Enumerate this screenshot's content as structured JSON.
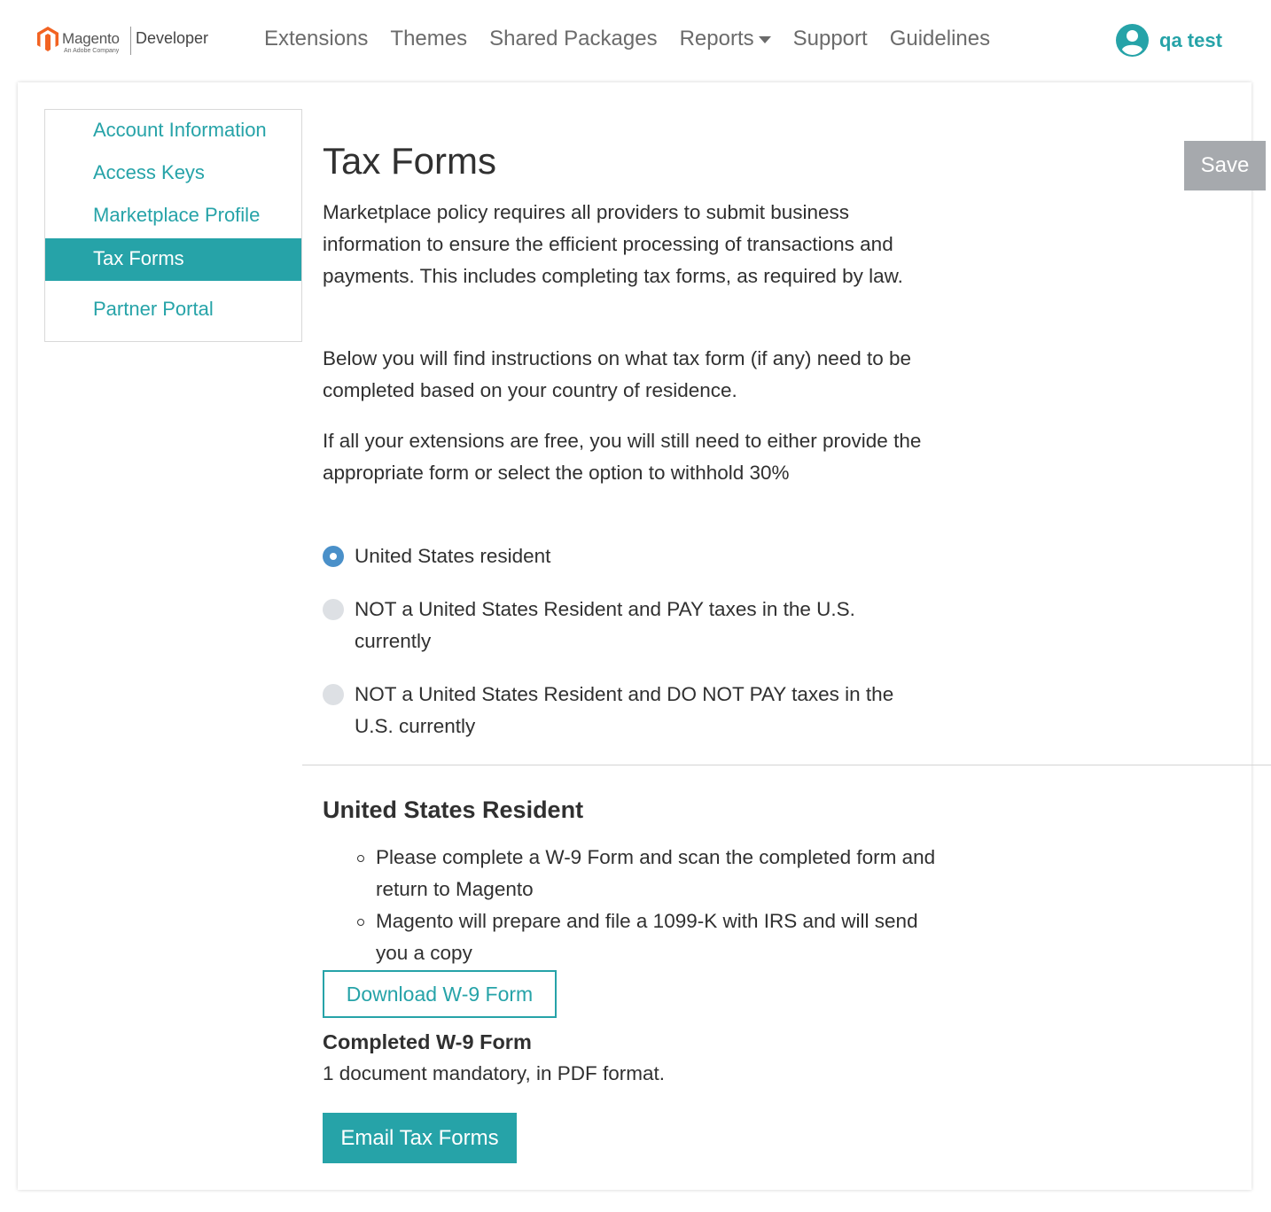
{
  "header": {
    "logo": {
      "brand": "Magento",
      "sub": "An Adobe Company",
      "product": "Developer"
    },
    "nav": [
      {
        "label": "Extensions"
      },
      {
        "label": "Themes"
      },
      {
        "label": "Shared Packages"
      },
      {
        "label": "Reports",
        "dropdown": true
      },
      {
        "label": "Support"
      },
      {
        "label": "Guidelines"
      }
    ],
    "user": {
      "name": "qa test",
      "icon": "user-avatar-icon"
    }
  },
  "sidebar": {
    "items": [
      {
        "label": "Account Information",
        "active": false
      },
      {
        "label": "Access Keys",
        "active": false
      },
      {
        "label": "Marketplace Profile",
        "active": false
      },
      {
        "label": "Tax Forms",
        "active": true
      },
      {
        "label": "Partner Portal",
        "active": false
      }
    ]
  },
  "main": {
    "title": "Tax Forms",
    "save_label": "Save",
    "paragraphs": [
      "Marketplace policy requires all providers to submit business information to ensure the efficient processing of transactions and payments. This includes completing tax forms, as required by law.",
      "Below you will find instructions on what tax form (if any) need to be completed based on your country of residence.",
      "If all your extensions are free, you will still need to either provide the appropriate form or select the option to withhold 30%"
    ],
    "residency_options": [
      {
        "label": "United States resident",
        "selected": true
      },
      {
        "label": "NOT a United States Resident and PAY taxes in the U.S. currently",
        "selected": false
      },
      {
        "label": "NOT a United States Resident and DO NOT PAY taxes in the U.S. currently",
        "selected": false
      }
    ],
    "section": {
      "heading": "United States Resident",
      "bullets": [
        "Please complete a W-9 Form and scan the completed form and return to Magento",
        "Magento will prepare and file a 1099-K with IRS and will send you a copy"
      ],
      "download_label": "Download W-9 Form",
      "upload_heading": "Completed W-9 Form",
      "upload_note": "1 document mandatory, in PDF format.",
      "email_label": "Email Tax Forms"
    }
  },
  "colors": {
    "accent": "#26a3a8",
    "radio_checked": "#4a90c9",
    "save_disabled": "#a6a9ad",
    "logo_orange": "#f26322"
  }
}
